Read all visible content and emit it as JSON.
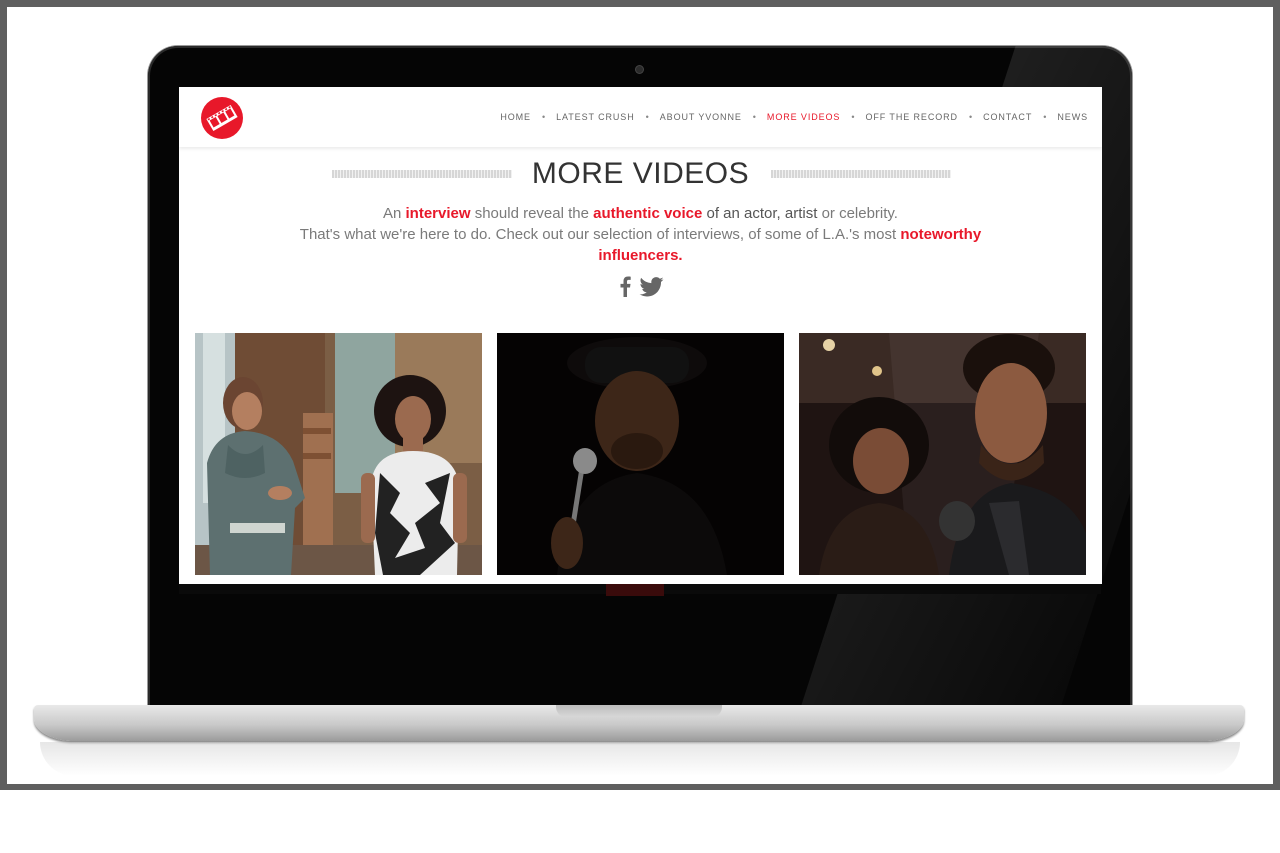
{
  "nav": {
    "items": [
      {
        "label": "HOME",
        "active": false
      },
      {
        "label": "LATEST CRUSH",
        "active": false
      },
      {
        "label": "ABOUT YVONNE",
        "active": false
      },
      {
        "label": "MORE VIDEOS",
        "active": true
      },
      {
        "label": "OFF THE RECORD",
        "active": false
      },
      {
        "label": "CONTACT",
        "active": false
      },
      {
        "label": "NEWS",
        "active": false
      }
    ],
    "separator": "•"
  },
  "page": {
    "title": "MORE VIDEOS",
    "intro": {
      "p1": "An ",
      "h1": "interview",
      "p2": " should reveal the ",
      "h2": "authentic voice",
      "p3": " of an actor, artist ",
      "p4": "or celebrity.",
      "p5": "That's what we're here to do. Check out our selection of interviews, of some of L.A.'s most ",
      "h3": "noteworthy influencers."
    }
  },
  "social": {
    "facebook_icon": "facebook-icon",
    "twitter_icon": "twitter-icon"
  },
  "videos": [
    {
      "icon": "video-thumbnail-kitchen-interview"
    },
    {
      "icon": "video-thumbnail-microphone-interview"
    },
    {
      "icon": "video-thumbnail-event-interview"
    }
  ],
  "colors": {
    "accent": "#e8182a",
    "text": "#7a7a7a",
    "frame": "#5f5f5f"
  }
}
